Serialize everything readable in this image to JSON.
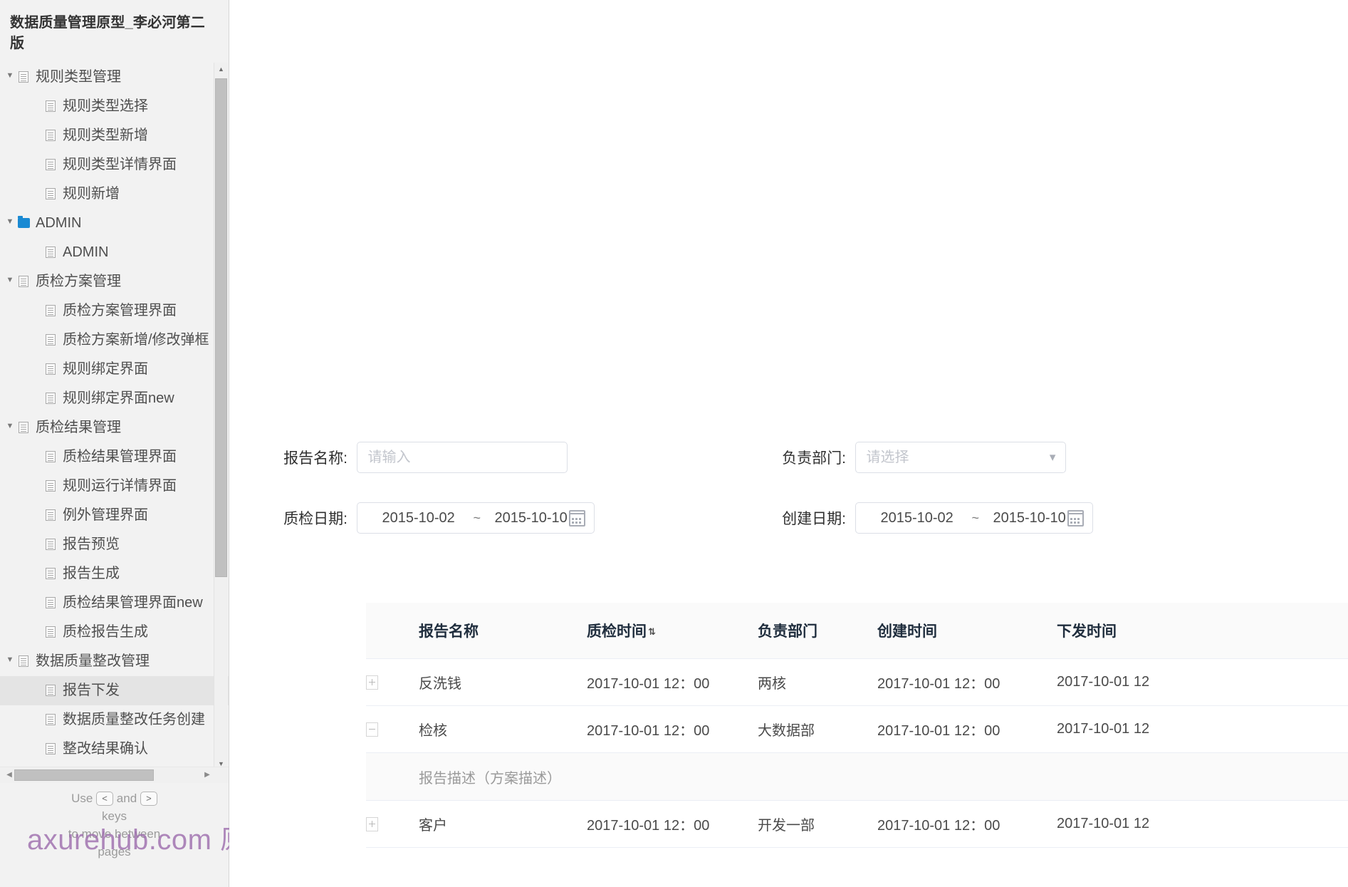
{
  "sidebar": {
    "title": "数据质量管理原型_李必河第二版",
    "tree": [
      {
        "label": "规则类型管理",
        "depth": 1,
        "icon": "page-icon",
        "expanded": true,
        "selected": false
      },
      {
        "label": "规则类型选择",
        "depth": 2,
        "icon": "page-icon",
        "expanded": null,
        "selected": false
      },
      {
        "label": "规则类型新增",
        "depth": 2,
        "icon": "page-icon",
        "expanded": null,
        "selected": false
      },
      {
        "label": "规则类型详情界面",
        "depth": 2,
        "icon": "page-icon",
        "expanded": null,
        "selected": false
      },
      {
        "label": "规则新增",
        "depth": 2,
        "icon": "page-icon",
        "expanded": null,
        "selected": false
      },
      {
        "label": "ADMIN",
        "depth": 1,
        "icon": "folder-icon",
        "expanded": true,
        "selected": false
      },
      {
        "label": "ADMIN",
        "depth": 2,
        "icon": "page-icon",
        "expanded": null,
        "selected": false
      },
      {
        "label": "质检方案管理",
        "depth": 1,
        "icon": "page-icon",
        "expanded": true,
        "selected": false
      },
      {
        "label": "质检方案管理界面",
        "depth": 2,
        "icon": "page-icon",
        "expanded": null,
        "selected": false
      },
      {
        "label": "质检方案新增/修改弹框",
        "depth": 2,
        "icon": "page-icon",
        "expanded": null,
        "selected": false
      },
      {
        "label": "规则绑定界面",
        "depth": 2,
        "icon": "page-icon",
        "expanded": null,
        "selected": false
      },
      {
        "label": "规则绑定界面new",
        "depth": 2,
        "icon": "page-icon",
        "expanded": null,
        "selected": false
      },
      {
        "label": "质检结果管理",
        "depth": 1,
        "icon": "page-icon",
        "expanded": true,
        "selected": false
      },
      {
        "label": "质检结果管理界面",
        "depth": 2,
        "icon": "page-icon",
        "expanded": null,
        "selected": false
      },
      {
        "label": "规则运行详情界面",
        "depth": 2,
        "icon": "page-icon",
        "expanded": null,
        "selected": false
      },
      {
        "label": "例外管理界面",
        "depth": 2,
        "icon": "page-icon",
        "expanded": null,
        "selected": false
      },
      {
        "label": "报告预览",
        "depth": 2,
        "icon": "page-icon",
        "expanded": null,
        "selected": false
      },
      {
        "label": "报告生成",
        "depth": 2,
        "icon": "page-icon",
        "expanded": null,
        "selected": false
      },
      {
        "label": "质检结果管理界面new",
        "depth": 2,
        "icon": "page-icon",
        "expanded": null,
        "selected": false
      },
      {
        "label": "质检报告生成",
        "depth": 2,
        "icon": "page-icon",
        "expanded": null,
        "selected": false
      },
      {
        "label": "数据质量整改管理",
        "depth": 1,
        "icon": "page-icon",
        "expanded": true,
        "selected": false
      },
      {
        "label": "报告下发",
        "depth": 2,
        "icon": "page-icon",
        "expanded": null,
        "selected": true
      },
      {
        "label": "数据质量整改任务创建",
        "depth": 2,
        "icon": "page-icon",
        "expanded": null,
        "selected": false
      },
      {
        "label": "整改结果确认",
        "depth": 2,
        "icon": "page-icon",
        "expanded": null,
        "selected": false
      }
    ],
    "footer": {
      "use": "Use",
      "key_prev": "<",
      "key_next": ">",
      "and": "and",
      "line2": "keys",
      "line3": "to move between",
      "line4": "pages"
    }
  },
  "watermark": {
    "text_en": "axurehub.com",
    "text_cn": "原型资源站"
  },
  "filters": {
    "report_name": {
      "label": "报告名称:",
      "placeholder": "请输入",
      "value": ""
    },
    "department": {
      "label": "负责部门:",
      "placeholder": "请选择",
      "value": "",
      "caret": "chevron-down-icon"
    },
    "inspect_date": {
      "label": "质检日期:",
      "start": "2015-10-02",
      "separator": "~",
      "end": "2015-10-10",
      "icon": "calendar-icon"
    },
    "create_date": {
      "label": "创建日期:",
      "start": "2015-10-02",
      "separator": "~",
      "end": "2015-10-10",
      "icon": "calendar-icon"
    }
  },
  "table": {
    "columns": [
      {
        "key": "expander",
        "label": ""
      },
      {
        "key": "name",
        "label": "报告名称"
      },
      {
        "key": "inspect_time",
        "label": "质检时间",
        "sortable": true,
        "sort_glyph": "⇅"
      },
      {
        "key": "department",
        "label": "负责部门"
      },
      {
        "key": "create_time",
        "label": "创建时间"
      },
      {
        "key": "send_time",
        "label": "下发时间"
      }
    ],
    "rows": [
      {
        "expander": "plus",
        "name": "反洗钱",
        "inspect_time": "2017-10-01 12：00",
        "department": "两核",
        "create_time": "2017-10-01 12：00",
        "send_time": "2017-10-01 12"
      },
      {
        "expander": "minus",
        "name": "检核",
        "inspect_time": "2017-10-01 12：00",
        "department": "大数据部",
        "create_time": "2017-10-01 12：00",
        "send_time": "2017-10-01 12"
      },
      {
        "expander": "plus",
        "name": "客户",
        "inspect_time": "2017-10-01 12：00",
        "department": "开发一部",
        "create_time": "2017-10-01 12：00",
        "send_time": "2017-10-01 12"
      }
    ],
    "detail_row": {
      "text": "报告描述（方案描述）"
    }
  },
  "colors": {
    "accent": "#1a8ad3",
    "selected_row": "#e4e4e4",
    "table_header_bg": "#fafafa",
    "border": "#ebeef5",
    "watermark": "#9e6fae"
  }
}
